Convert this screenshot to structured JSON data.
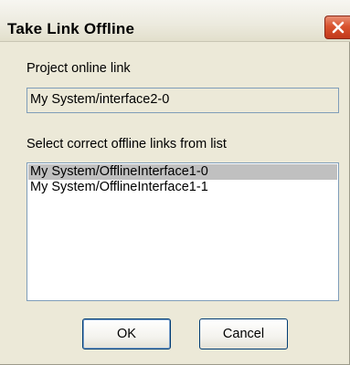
{
  "window": {
    "title": "Take Link Offline"
  },
  "online_link": {
    "label": "Project online link",
    "value": "My System/interface2-0"
  },
  "offline_links": {
    "label": "Select correct offline links from list",
    "items": [
      {
        "label": "My System/OfflineInterface1-0",
        "selected": true
      },
      {
        "label": "My System/OfflineInterface1-1",
        "selected": false
      }
    ]
  },
  "buttons": {
    "ok": "OK",
    "cancel": "Cancel"
  },
  "colors": {
    "dialog_background": "#ece9d8",
    "close_button": "#d9532f",
    "selection": "#c0c0c0"
  },
  "icons": {
    "close": "close-icon"
  }
}
